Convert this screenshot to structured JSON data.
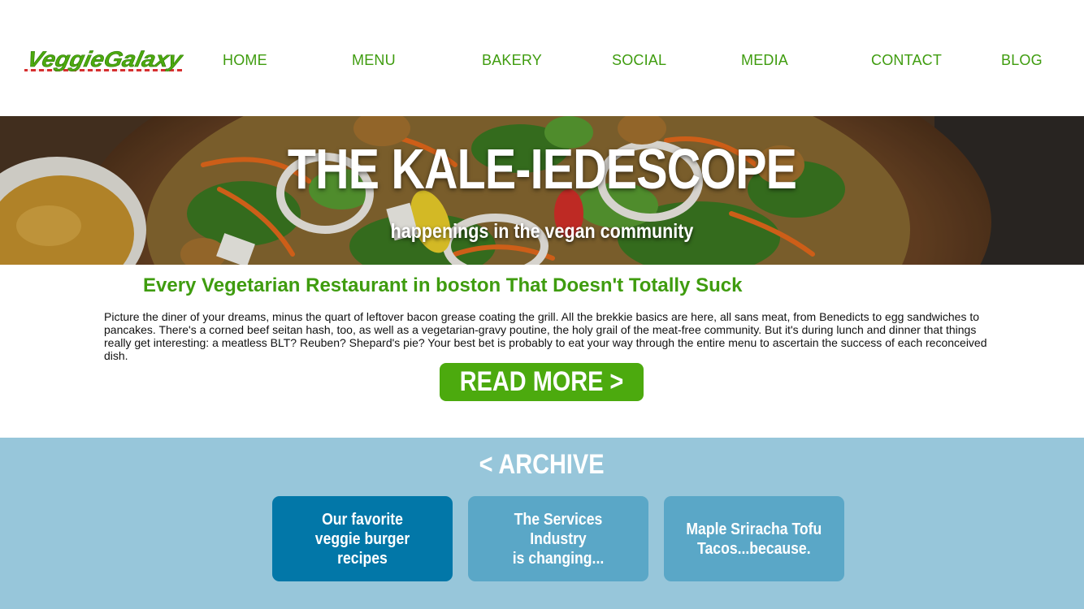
{
  "brand": {
    "logo_text": "VeggieGalaxy"
  },
  "nav": {
    "items": [
      {
        "label": "HOME"
      },
      {
        "label": "MENU"
      },
      {
        "label": "BAKERY"
      },
      {
        "label": "SOCIAL"
      },
      {
        "label": "MEDIA"
      },
      {
        "label": "CONTACT"
      },
      {
        "label": "BLOG"
      }
    ]
  },
  "hero": {
    "title": "THE KALE-IEDESCOPE",
    "subtitle": "happenings in the vegan community"
  },
  "article": {
    "title": "Every Vegetarian Restaurant in boston That Doesn't Totally Suck",
    "body": "Picture the diner of your dreams, minus the quart of leftover bacon grease coating the grill. All the brekkie basics are here, all sans meat, from Benedicts to egg sandwiches to pancakes. There's a corned beef seitan hash, too, as well as a vegetarian-gravy poutine, the holy grail of the meat-free community. But it's during lunch and dinner that things really get interesting: a meatless BLT? Reuben? Shepard's pie? Your best bet is probably to eat your way through the entire menu to ascertain the success of each reconceived dish.",
    "read_more_label": "READ MORE >"
  },
  "archive": {
    "heading": "< ARCHIVE",
    "cards": [
      {
        "label": "Our favorite\nveggie burger recipes"
      },
      {
        "label": "The Services Industry\nis changing..."
      },
      {
        "label": "Maple Sriracha Tofu\nTacos...because."
      }
    ]
  },
  "colors": {
    "brand_green": "#3f9c0f",
    "button_green": "#4caa0e",
    "archive_bg": "#97c6da",
    "card_active": "#0277a8",
    "card_default": "#5aa7c7"
  }
}
